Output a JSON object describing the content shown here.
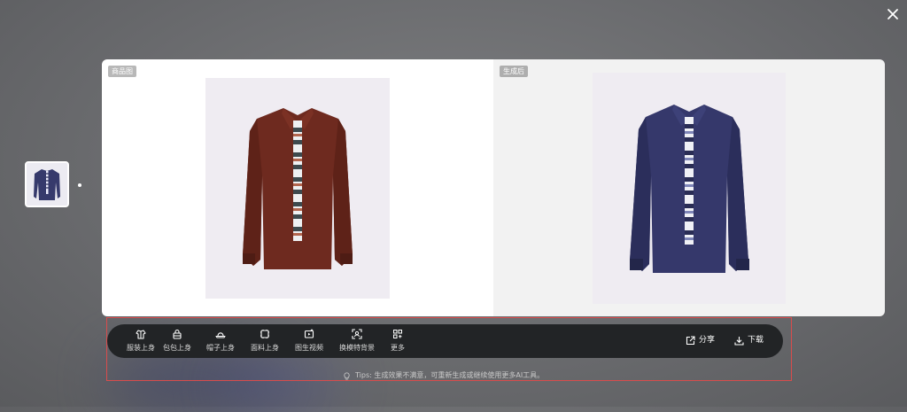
{
  "window": {
    "close_icon": "close-icon"
  },
  "thumbnails": [
    {
      "alt": "navy shirt with tie"
    }
  ],
  "compare": {
    "left": {
      "tag": "商品图",
      "image": "rust-shirt-with-patterned-tie"
    },
    "right": {
      "tag": "生成后",
      "image": "navy-shirt-with-patterned-tie"
    }
  },
  "toolbar": {
    "tools": [
      {
        "label": "服装上身",
        "icon": "shirt-icon"
      },
      {
        "label": "包包上身",
        "icon": "bag-icon"
      },
      {
        "label": "帽子上身",
        "icon": "hat-icon"
      },
      {
        "label": "面料上身",
        "icon": "fabric-icon"
      },
      {
        "label": "图生视频",
        "icon": "video-icon"
      },
      {
        "label": "换模特背景",
        "icon": "scan-icon"
      },
      {
        "label": "更多",
        "icon": "grid-plus-icon"
      }
    ],
    "share_label": "分享",
    "download_label": "下载"
  },
  "tips": "Tips: 生成效果不满意，可重新生成或继续使用更多AI工具。",
  "colors": {
    "toolbar_bg": "#222426",
    "selection_border": "#d94c4c",
    "shirt_rust": "#6e2a1f",
    "shirt_navy": "#35386b"
  }
}
